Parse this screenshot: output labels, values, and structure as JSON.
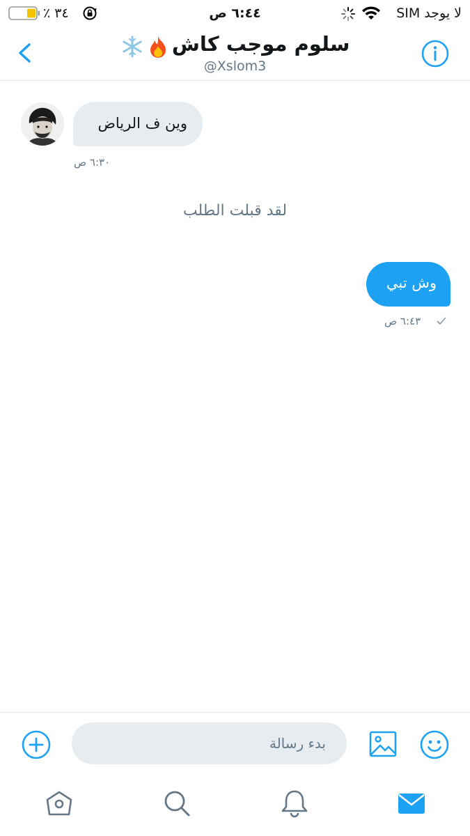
{
  "status_bar": {
    "carrier": "لا يوجد SIM",
    "time": "٦:٤٤ ص",
    "battery_percent": "٣٤ ٪"
  },
  "header": {
    "title": "سلوم  موجب كاش",
    "handle": "@Xslom3",
    "back_icon": "chevron-left-icon",
    "info_icon": "info-icon"
  },
  "messages": {
    "incoming": {
      "text": "وين ف الرياض",
      "time": "٦:٣٠ ص"
    },
    "system": "لقد قبلت الطلب",
    "outgoing": {
      "text": "وش تبي",
      "time": "٦:٤٣ ص"
    }
  },
  "composer": {
    "placeholder": "بدء رسالة",
    "add_icon": "plus-circle-icon",
    "image_icon": "image-icon",
    "emoji_icon": "smiley-icon"
  },
  "tabbar": {
    "items": [
      "home-icon",
      "search-icon",
      "bell-icon",
      "envelope-icon"
    ],
    "active": "envelope-icon"
  },
  "colors": {
    "accent": "#1da1f2",
    "bubble_in": "#e6ecf0",
    "secondary_text": "#657786",
    "battery_fill": "#f5c400"
  }
}
